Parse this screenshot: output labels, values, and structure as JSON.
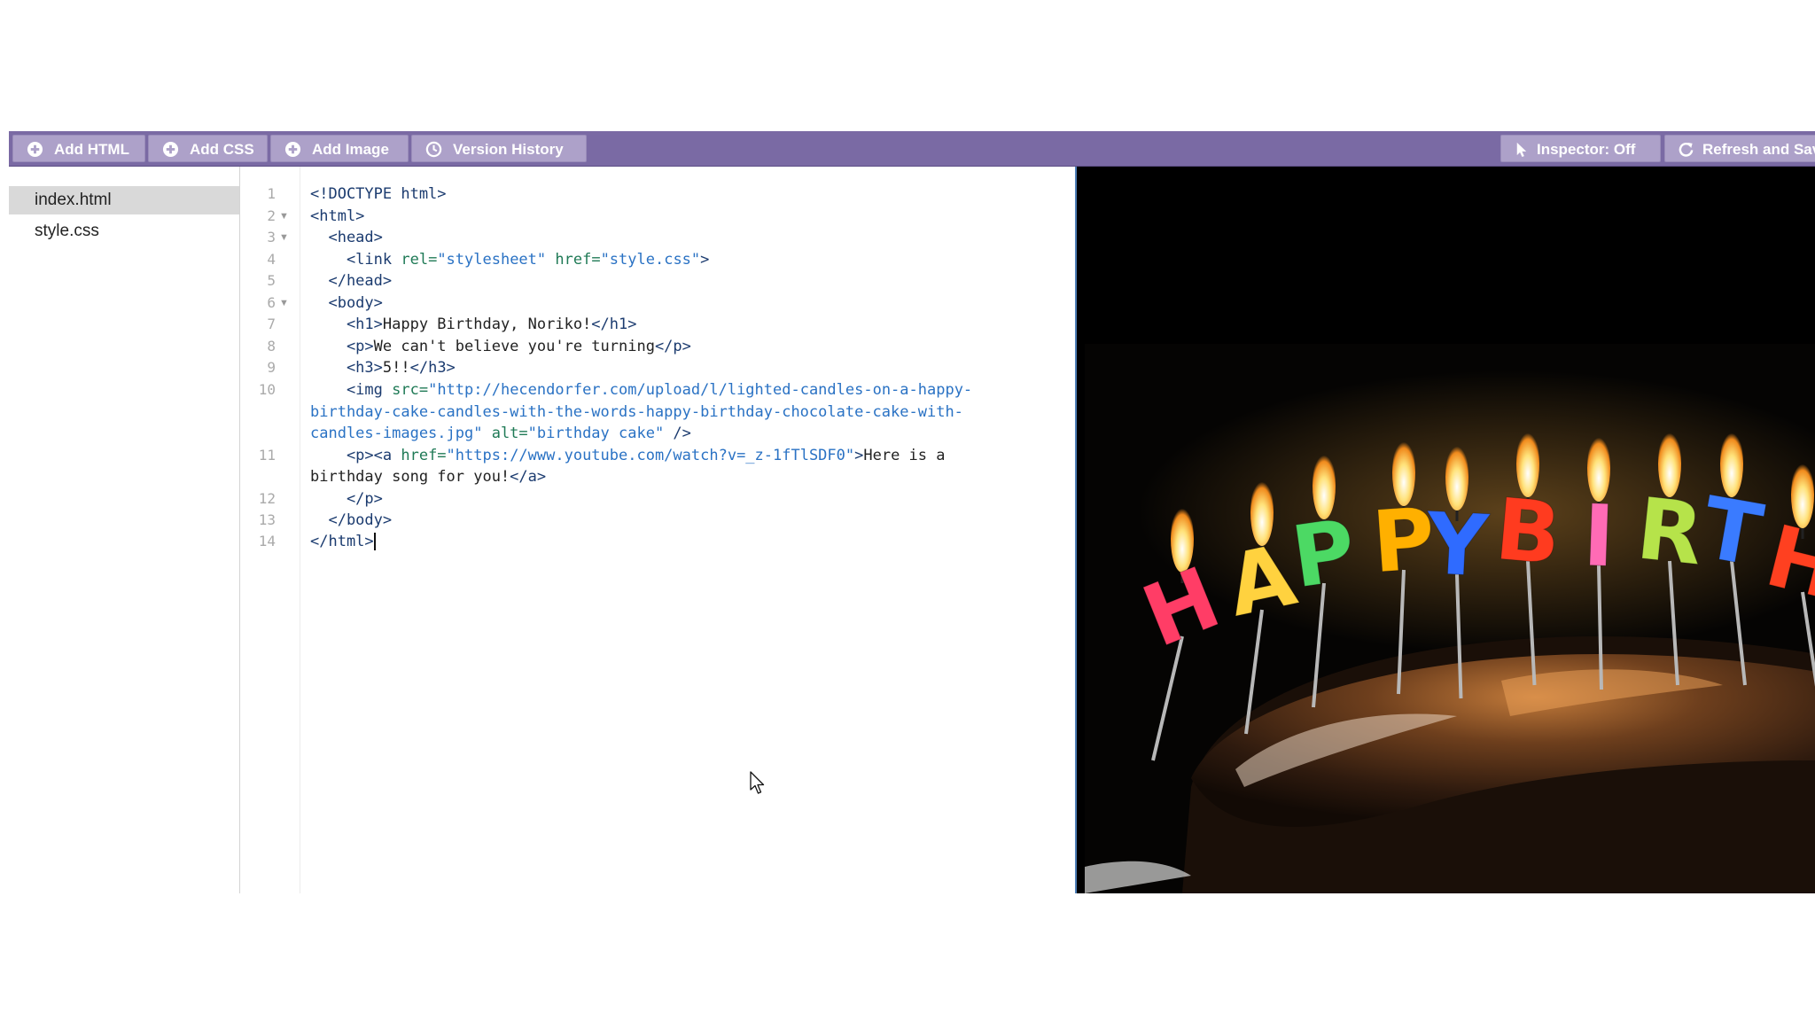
{
  "toolbar": {
    "buttons": [
      {
        "label": "Add HTML",
        "icon": "plus-circle-icon"
      },
      {
        "label": "Add CSS",
        "icon": "plus-circle-icon"
      },
      {
        "label": "Add Image",
        "icon": "plus-circle-icon"
      },
      {
        "label": "Version History",
        "icon": "clock-icon"
      }
    ],
    "inspector_label": "Inspector: Off",
    "refresh_label": "Refresh and Sav",
    "colors": {
      "bar": "#7a6aa4",
      "button": "#ada1c9"
    }
  },
  "files": [
    {
      "name": "index.html",
      "active": true
    },
    {
      "name": "style.css",
      "active": false
    }
  ],
  "editor": {
    "line_numbers": [
      "1",
      "2",
      "3",
      "4",
      "5",
      "6",
      "7",
      "8",
      "9",
      "10",
      "11",
      "12",
      "13",
      "14"
    ],
    "lines": [
      [
        {
          "t": "tag",
          "v": "<!DOCTYPE html>"
        }
      ],
      [
        {
          "t": "tag",
          "v": "<html>"
        }
      ],
      [
        {
          "t": "tag",
          "v": "  <head>"
        }
      ],
      [
        {
          "t": "tag",
          "v": "    <link "
        },
        {
          "t": "attr",
          "v": "rel="
        },
        {
          "t": "str",
          "v": "\"stylesheet\""
        },
        {
          "t": "attr",
          "v": " href="
        },
        {
          "t": "str",
          "v": "\"style.css\""
        },
        {
          "t": "tag",
          "v": ">"
        }
      ],
      [
        {
          "t": "tag",
          "v": "  </head>"
        }
      ],
      [
        {
          "t": "tag",
          "v": "  <body>"
        }
      ],
      [
        {
          "t": "tag",
          "v": "    <h1>"
        },
        {
          "t": "txt",
          "v": "Happy Birthday, Noriko!"
        },
        {
          "t": "tag",
          "v": "</h1>"
        }
      ],
      [
        {
          "t": "tag",
          "v": "    <p>"
        },
        {
          "t": "txt",
          "v": "We can't believe you're turning"
        },
        {
          "t": "tag",
          "v": "</p>"
        }
      ],
      [
        {
          "t": "tag",
          "v": "    <h3>"
        },
        {
          "t": "txt",
          "v": "5!!"
        },
        {
          "t": "tag",
          "v": "</h3>"
        }
      ],
      [
        {
          "t": "tag",
          "v": "    <img "
        },
        {
          "t": "attr",
          "v": "src="
        },
        {
          "t": "str",
          "v": "\"http://hecendorfer.com/upload/l/lighted-candles-on-a-happy-"
        }
      ],
      [
        {
          "t": "str",
          "v": "birthday-cake-candles-with-the-words-happy-birthday-chocolate-cake-with-"
        }
      ],
      [
        {
          "t": "str",
          "v": "candles-images.jpg\""
        },
        {
          "t": "attr",
          "v": " alt="
        },
        {
          "t": "str",
          "v": "\"birthday cake\""
        },
        {
          "t": "tag",
          "v": " />"
        }
      ],
      [
        {
          "t": "tag",
          "v": "    <p><a "
        },
        {
          "t": "attr",
          "v": "href="
        },
        {
          "t": "str",
          "v": "\"https://www.youtube.com/watch?v=_z-1fTlSDF0\""
        },
        {
          "t": "tag",
          "v": ">"
        },
        {
          "t": "txt",
          "v": "Here is a"
        }
      ],
      [
        {
          "t": "txt",
          "v": "birthday song for you!"
        },
        {
          "t": "tag",
          "v": "</a>"
        }
      ],
      [
        {
          "t": "tag",
          "v": "    </p>"
        }
      ],
      [
        {
          "t": "tag",
          "v": "  </body>"
        }
      ],
      [
        {
          "t": "tag",
          "v": "</html>"
        }
      ]
    ]
  },
  "preview": {
    "image_alt": "birthday cake",
    "candle_letters": [
      "H",
      "A",
      "P",
      "P",
      "Y",
      "B",
      "I",
      "R",
      "T",
      "H"
    ]
  }
}
